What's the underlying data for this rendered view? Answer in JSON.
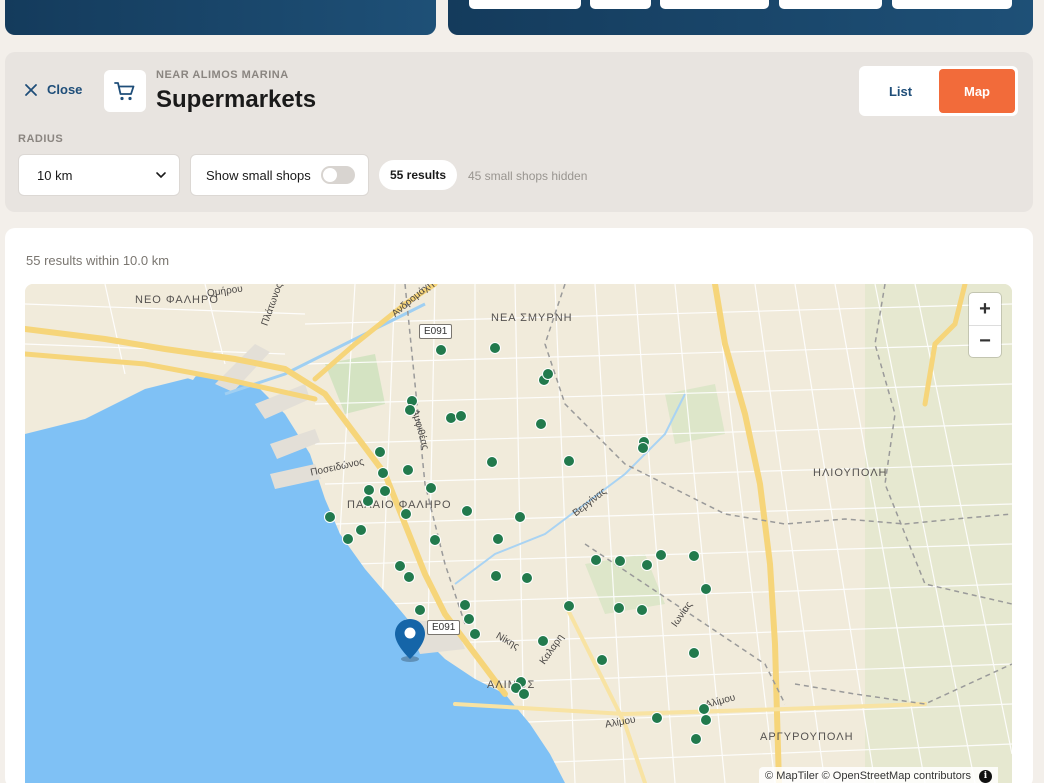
{
  "header": {
    "close_label": "Close",
    "near_label": "NEAR ALIMOS MARINA",
    "title": "Supermarkets",
    "category_icon": "shopping-cart-icon"
  },
  "view_toggle": {
    "list_label": "List",
    "map_label": "Map",
    "active": "Map",
    "active_color": "#f26b3a"
  },
  "filters": {
    "radius_label": "RADIUS",
    "radius_value": "10 km",
    "small_shops_label": "Show small shops",
    "small_shops_enabled": false,
    "results_count": "55 results",
    "hidden_note": "45 small shops hidden"
  },
  "results": {
    "summary": "55 results within 10.0 km"
  },
  "map": {
    "areas": [
      "ΝΕΟ ΦΑΛΗΡΟ",
      "ΝΕΑ ΣΜΥΡΝΗ",
      "ΠΑΛΑΙΟ ΦΑΛΗΡΟ",
      "ΗΛΙΟΥΠΟΛΗ",
      "ΑΛΙΜΟΣ",
      "ΑΡΓΥΡΟΥΠΟΛΗ"
    ],
    "streets": [
      "Ομήρου",
      "Πλάτωνος",
      "Ανδρομάχης",
      "Ποσειδώνος",
      "Αμφιθέας",
      "Βεργίνας",
      "Νίκης",
      "Καλαρη",
      "Ιωνίας",
      "Αλίμου",
      "Αλίμου"
    ],
    "road_shields": [
      "E091",
      "E091"
    ],
    "zoom_in": "+",
    "zoom_out": "−",
    "attribution": "© MapTiler © OpenStreetMap contributors",
    "marker_color": "#227a4d",
    "pin_color": "#1565a8"
  }
}
